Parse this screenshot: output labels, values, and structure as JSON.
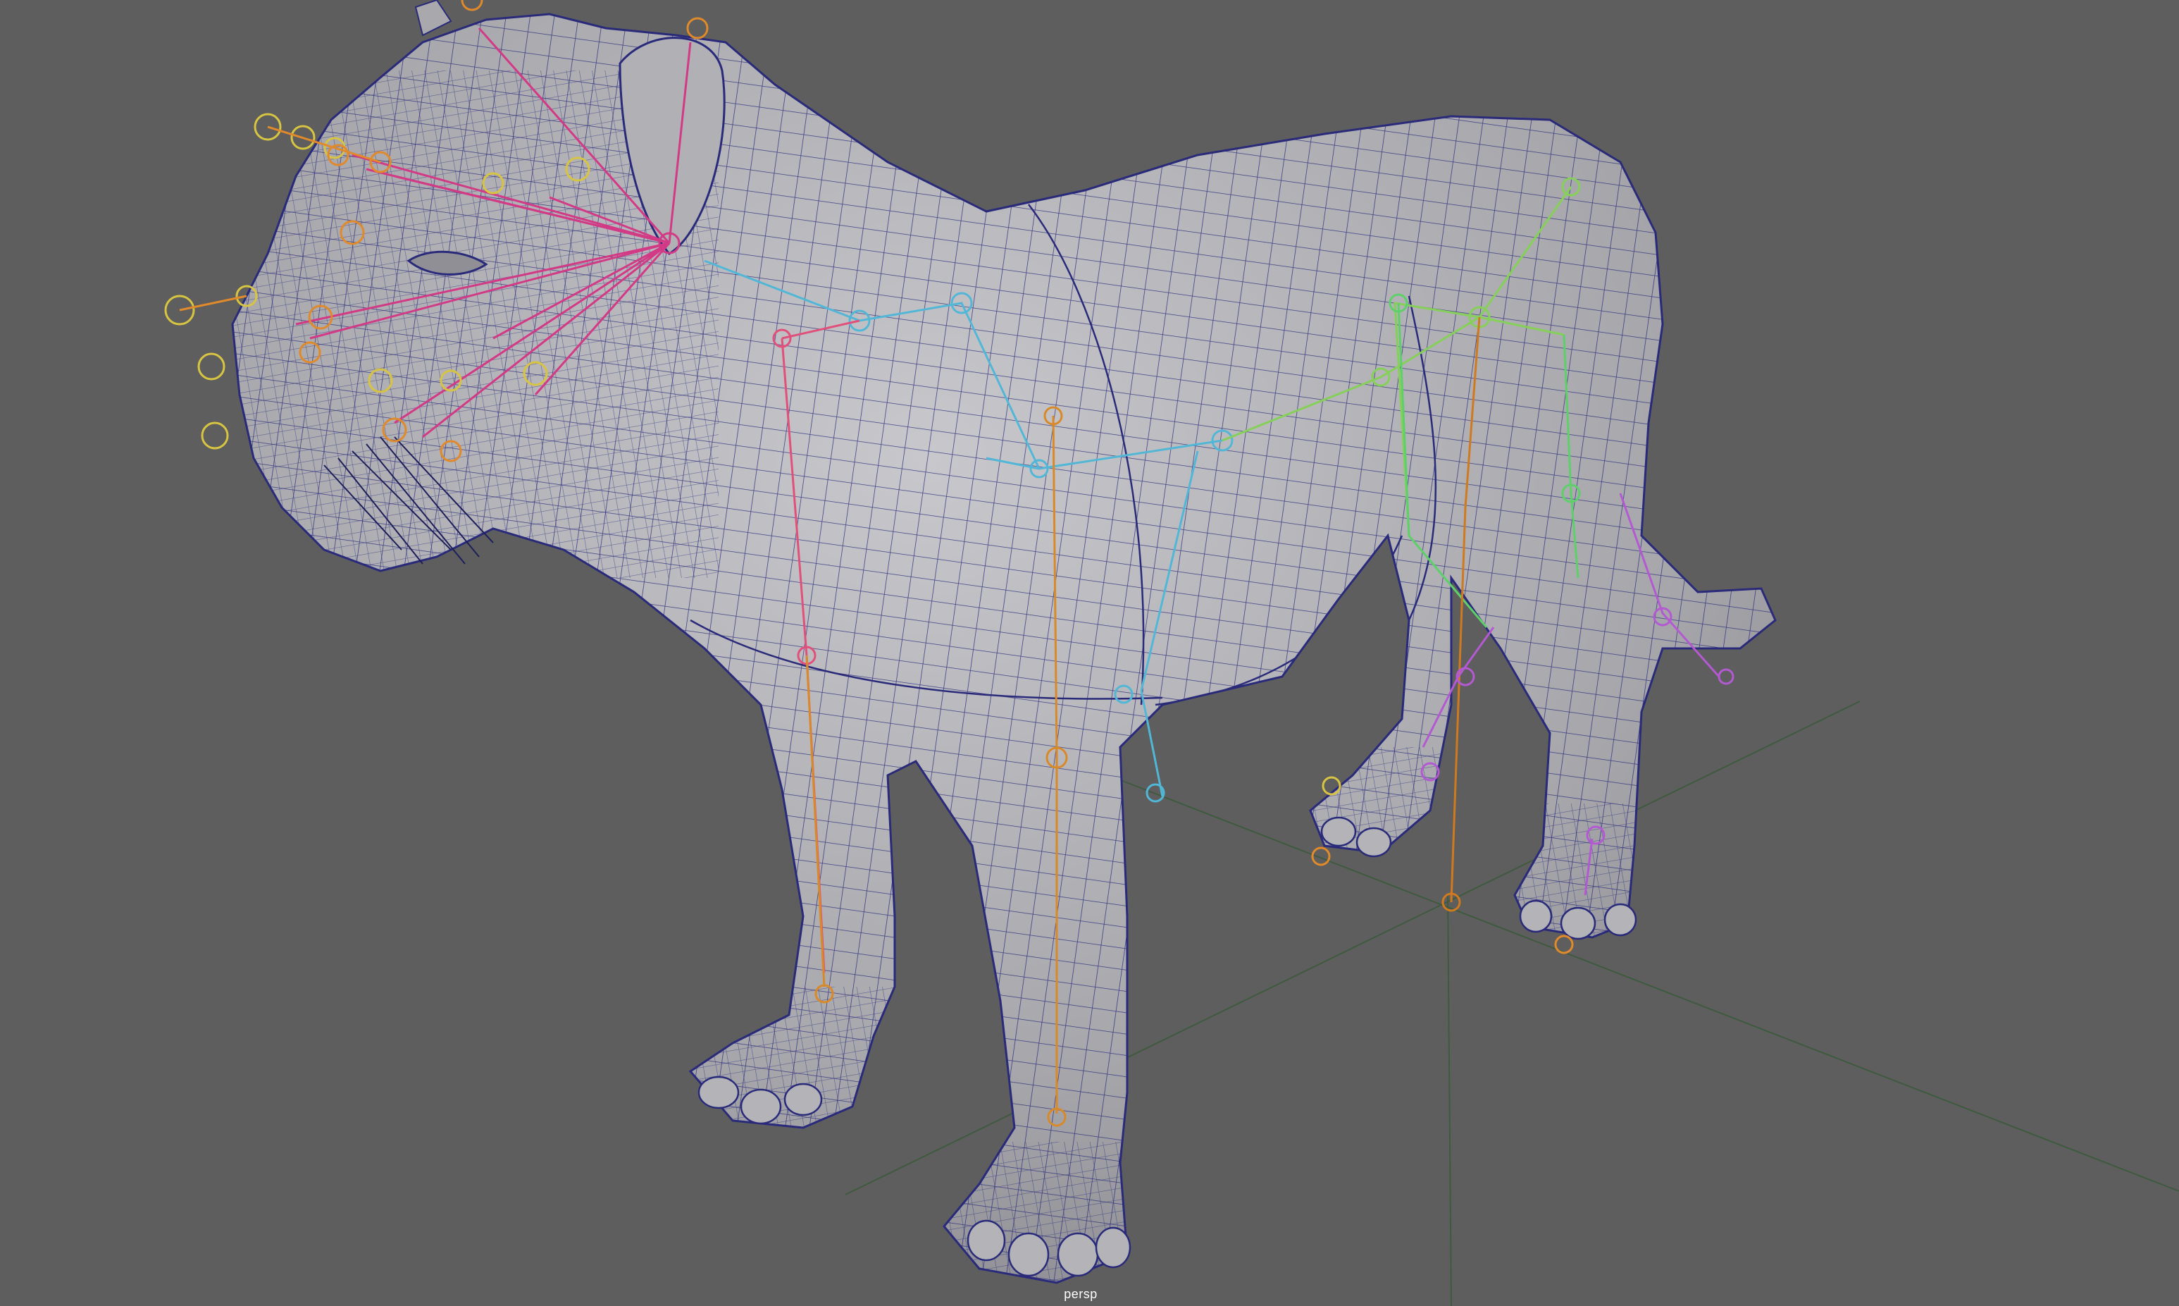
{
  "viewport": {
    "camera_name": "persp",
    "background_color": "#5e5e5e",
    "mesh_color": "#a9a9ad",
    "wireframe_color": "#2a2a7a",
    "grid_color": "#3c5a3c"
  },
  "rig_colors": {
    "face_joints": "#d23a86",
    "face_controls": "#d7c442",
    "face_controls_alt": "#e08a2c",
    "spine_front": "#52b7d6",
    "spine_back": "#86d05a",
    "front_leg_left": "#e0507a",
    "front_leg_right": "#d88a2a",
    "back_leg_left": "#5ed06a",
    "back_leg_right": "#d07a20",
    "tail": "#b35ad2"
  }
}
